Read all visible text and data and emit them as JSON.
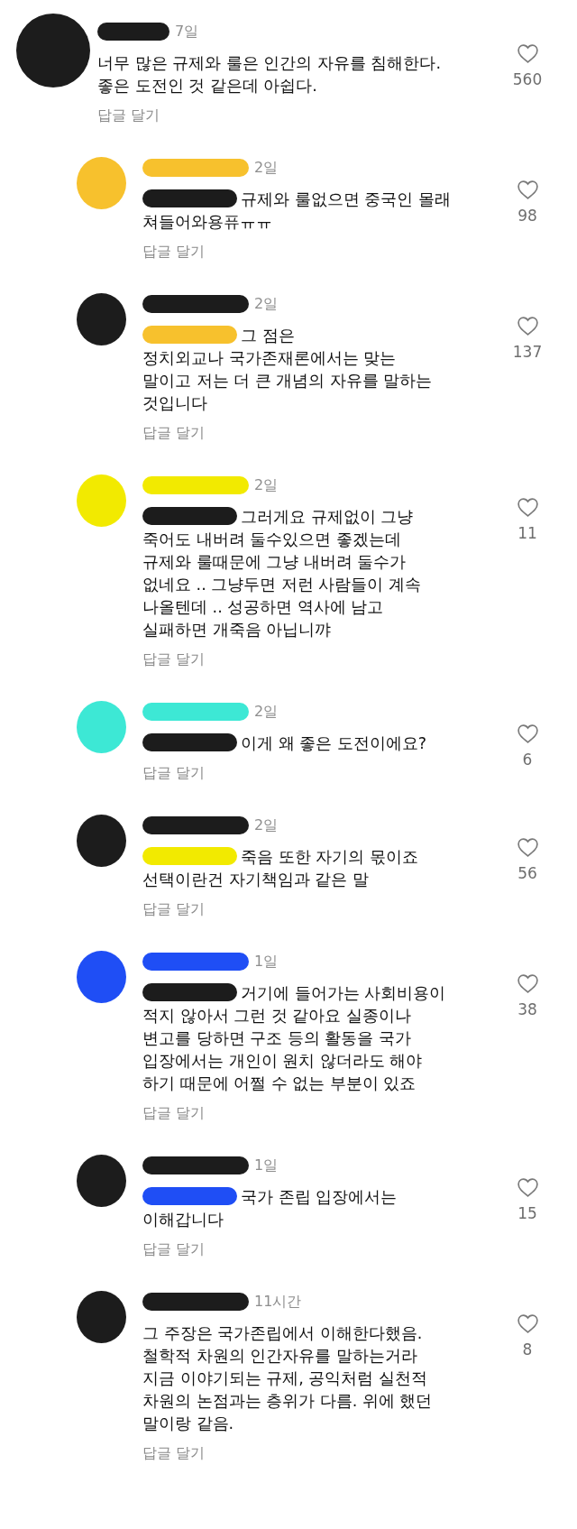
{
  "comments": [
    {
      "kind": "comment",
      "avatar": {
        "color": "#1c1c1c"
      },
      "name": {
        "color": "#1c1c1c"
      },
      "time": "7일",
      "text": "너무 많은 규제와 룰은 인간의 자유를 침해한다.\n좋은 도전인 것 같은데 아쉽다.",
      "reply_label": "답글 달기",
      "likes": "560"
    },
    {
      "kind": "reply",
      "avatar": {
        "color": "#f7c12d"
      },
      "name": {
        "color": "#f7c12d"
      },
      "mention": {
        "color": "#1c1c1c"
      },
      "time": "2일",
      "text": "규제와 룰없으면 중국인 몰래\n쳐들어와용퓨ㅠㅠ",
      "reply_label": "답글 달기",
      "likes": "98"
    },
    {
      "kind": "reply",
      "avatar": {
        "color": "#1c1c1c"
      },
      "name": {
        "color": "#1c1c1c"
      },
      "mention": {
        "color": "#f7c12d"
      },
      "time": "2일",
      "text": "그 점은\n정치외교나 국가존재론에서는 맞는\n말이고 저는 더 큰 개념의 자유를 말하는\n것입니다",
      "reply_label": "답글 달기",
      "likes": "137"
    },
    {
      "kind": "reply",
      "avatar": {
        "color": "#f2ea00"
      },
      "name": {
        "color": "#f2ea00"
      },
      "mention": {
        "color": "#1c1c1c"
      },
      "time": "2일",
      "text": "그러게요 규제없이 그냥\n죽어도 내버려 둘수있으면 좋겠는데\n규제와 룰때문에 그냥 내버려 둘수가\n없네요 .. 그냥두면 저런 사람들이 계속\n나올텐데 .. 성공하면 역사에 남고\n실패하면 개죽음 아닙니꺄",
      "reply_label": "답글 달기",
      "likes": "11"
    },
    {
      "kind": "reply",
      "avatar": {
        "color": "#3de8d5"
      },
      "name": {
        "color": "#3de8d5"
      },
      "mention": {
        "color": "#1c1c1c"
      },
      "time": "2일",
      "text": "이게 왜 좋은 도전이에요?",
      "reply_label": "답글 달기",
      "likes": "6"
    },
    {
      "kind": "reply",
      "avatar": {
        "color": "#1c1c1c"
      },
      "name": {
        "color": "#1c1c1c"
      },
      "mention": {
        "color": "#f2ea00"
      },
      "time": "2일",
      "text": "죽음 또한 자기의 몫이죠\n선택이란건 자기책임과 같은 말",
      "reply_label": "답글 달기",
      "likes": "56"
    },
    {
      "kind": "reply",
      "avatar": {
        "color": "#1f4ef5"
      },
      "name": {
        "color": "#1f4ef5"
      },
      "mention": {
        "color": "#1c1c1c"
      },
      "time": "1일",
      "text": "거기에 들어가는 사회비용이\n적지 않아서 그런 것 같아요 실종이나\n변고를 당하면 구조 등의 활동을 국가\n입장에서는 개인이 원치 않더라도 해야\n하기 때문에 어쩔 수 없는 부분이 있죠",
      "reply_label": "답글 달기",
      "likes": "38"
    },
    {
      "kind": "reply",
      "avatar": {
        "color": "#1c1c1c"
      },
      "name": {
        "color": "#1c1c1c"
      },
      "mention": {
        "color": "#1f4ef5"
      },
      "time": "1일",
      "text": "국가 존립 입장에서는\n이해갑니다",
      "reply_label": "답글 달기",
      "likes": "15"
    },
    {
      "kind": "reply",
      "avatar": {
        "color": "#1c1c1c"
      },
      "name": {
        "color": "#1c1c1c"
      },
      "time": "11시간",
      "text": "그 주장은 국가존립에서 이해한다했음.\n철학적 차원의 인간자유를 말하는거라\n지금 이야기되는 규제, 공익처럼 실천적\n차원의 논점과는 층위가 다름. 위에 했던\n말이랑 같음.",
      "reply_label": "답글 달기",
      "likes": "8"
    }
  ]
}
